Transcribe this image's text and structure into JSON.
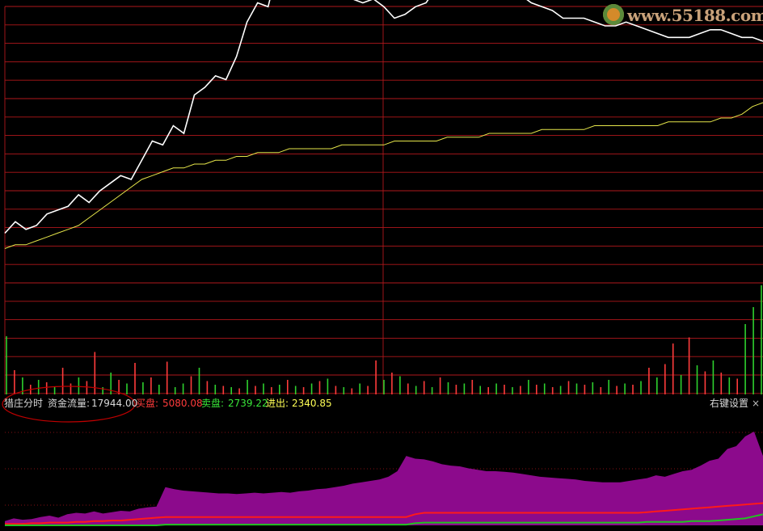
{
  "watermark": {
    "text": "www.55188.com"
  },
  "info": {
    "indicator_name": "猎庄分时",
    "flow_label": "资金流量:",
    "flow_value": "17944.00",
    "buy_label": "买盘:",
    "buy_value": "5080.08",
    "sell_label": "卖盘:",
    "sell_value": "2739.22",
    "net_label": "进出:",
    "net_value": "2340.85",
    "settings_label": "右键设置",
    "close_glyph": "×"
  },
  "colors": {
    "grid": "#b0171b",
    "price": "#ffffff",
    "avg": "#e6e64a",
    "vol_up": "#ff3b3b",
    "vol_down": "#2ed12e",
    "fill": "#8c0a8c",
    "buy": "#ff1a1a",
    "sell": "#21c421",
    "buy_text": "#ff3b3b",
    "sell_text": "#39e639",
    "net_text": "#ffff55",
    "label_text": "#d8d8d8",
    "ellipse": "#c00000",
    "axis_text": "#c0c0c0"
  },
  "chart_data": [
    {
      "type": "line",
      "series": [
        {
          "values": [
            42,
            45,
            43,
            44,
            47,
            48,
            49,
            52,
            50,
            53,
            55,
            57,
            56,
            61,
            66,
            65,
            70,
            68,
            78,
            80,
            83,
            82,
            88,
            97,
            102,
            101,
            112,
            110,
            107,
            106,
            105,
            104,
            104,
            103,
            102,
            103,
            101,
            98,
            99,
            101,
            102,
            106,
            108,
            110,
            112,
            112,
            112,
            108,
            107,
            104,
            102,
            101,
            100,
            98,
            98,
            98,
            97,
            96,
            96,
            97,
            96,
            95,
            94,
            93,
            93,
            93,
            94,
            95,
            95,
            94,
            93,
            93,
            92
          ]
        },
        {
          "values": [
            38,
            39,
            39,
            40,
            41,
            42,
            43,
            44,
            46,
            48,
            50,
            52,
            54,
            56,
            57,
            58,
            59,
            59,
            60,
            60,
            61,
            61,
            62,
            62,
            63,
            63,
            63,
            64,
            64,
            64,
            64,
            64,
            65,
            65,
            65,
            65,
            65,
            66,
            66,
            66,
            66,
            66,
            67,
            67,
            67,
            67,
            68,
            68,
            68,
            68,
            68,
            69,
            69,
            69,
            69,
            69,
            70,
            70,
            70,
            70,
            70,
            70,
            70,
            71,
            71,
            71,
            71,
            71,
            72,
            72,
            73,
            75,
            76
          ]
        }
      ]
    },
    {
      "type": "bar",
      "values": [
        48,
        20,
        14,
        8,
        12,
        10,
        6,
        22,
        9,
        14,
        11,
        35,
        6,
        18,
        12,
        9,
        26,
        10,
        14,
        8,
        27,
        6,
        9,
        15,
        22,
        11,
        8,
        7,
        6,
        5,
        12,
        7,
        9,
        6,
        8,
        12,
        7,
        6,
        9,
        11,
        13,
        7,
        6,
        5,
        9,
        7,
        28,
        12,
        18,
        15,
        9,
        7,
        11,
        6,
        14,
        10,
        8,
        9,
        12,
        7,
        6,
        9,
        8,
        6,
        7,
        12,
        8,
        9,
        6,
        7,
        11,
        9,
        8,
        10,
        6,
        12,
        7,
        9,
        8,
        11,
        22,
        14,
        25,
        42,
        16,
        47,
        24,
        19,
        28,
        18,
        14,
        13,
        58,
        72,
        90
      ],
      "colors": [
        "down",
        "up",
        "down",
        "up",
        "down",
        "up",
        "down",
        "up",
        "up",
        "down",
        "up",
        "up",
        "down",
        "down",
        "up",
        "down",
        "up",
        "down",
        "up",
        "down",
        "up",
        "down",
        "down",
        "up",
        "down",
        "up",
        "down",
        "up",
        "down",
        "up",
        "down",
        "up",
        "down",
        "up",
        "down",
        "up",
        "down",
        "up",
        "down",
        "up",
        "down",
        "up",
        "down",
        "up",
        "down",
        "up",
        "up",
        "down",
        "up",
        "down",
        "up",
        "down",
        "up",
        "down",
        "up",
        "down",
        "up",
        "down",
        "up",
        "down",
        "up",
        "down",
        "up",
        "down",
        "up",
        "down",
        "up",
        "down",
        "up",
        "down",
        "up",
        "down",
        "up",
        "down",
        "up",
        "down",
        "up",
        "down",
        "up",
        "down",
        "up",
        "down",
        "up",
        "up",
        "down",
        "up",
        "down",
        "up",
        "down",
        "up",
        "down",
        "up",
        "down",
        "down",
        "down"
      ]
    },
    {
      "type": "area",
      "series": [
        {
          "values": [
            6,
            10,
            8,
            9,
            12,
            14,
            11,
            16,
            18,
            17,
            20,
            17,
            19,
            21,
            20,
            24,
            26,
            27,
            55,
            52,
            50,
            49,
            48,
            47,
            46,
            46,
            45,
            46,
            47,
            46,
            47,
            48,
            47,
            49,
            50,
            52,
            53,
            55,
            57,
            60,
            62,
            64,
            66,
            70,
            78,
            100,
            96,
            95,
            92,
            88,
            86,
            85,
            82,
            80,
            78,
            78,
            77,
            76,
            74,
            72,
            70,
            69,
            68,
            67,
            66,
            64,
            63,
            62,
            62,
            62,
            64,
            66,
            68,
            72,
            70,
            74,
            78,
            80,
            86,
            93,
            96,
            110,
            114,
            128,
            135,
            100
          ]
        },
        {
          "values": [
            2,
            2,
            2,
            3,
            3,
            4,
            4,
            4,
            5,
            5,
            6,
            6,
            7,
            7,
            8,
            9,
            10,
            11,
            12,
            12,
            12,
            12,
            12,
            12,
            12,
            12,
            12,
            12,
            12,
            12,
            12,
            12,
            12,
            12,
            12,
            12,
            12,
            12,
            12,
            12,
            12,
            12,
            12,
            12,
            12,
            12,
            16,
            18,
            18,
            18,
            18,
            18,
            18,
            18,
            18,
            18,
            18,
            18,
            18,
            18,
            18,
            18,
            18,
            18,
            18,
            18,
            18,
            18,
            18,
            18,
            18,
            18,
            19,
            20,
            21,
            22,
            23,
            24,
            25,
            26,
            27,
            28,
            29,
            30,
            31,
            32
          ]
        },
        {
          "values": [
            0,
            0,
            0,
            0,
            0,
            0,
            0,
            0,
            0,
            0,
            0,
            0,
            0,
            0,
            0,
            0,
            0,
            0,
            1,
            1,
            1,
            1,
            1,
            1,
            1,
            1,
            1,
            1,
            1,
            1,
            1,
            1,
            1,
            1,
            1,
            1,
            1,
            1,
            1,
            1,
            1,
            1,
            1,
            1,
            1,
            1,
            3,
            4,
            4,
            4,
            4,
            4,
            4,
            4,
            4,
            4,
            4,
            4,
            4,
            4,
            4,
            4,
            4,
            4,
            4,
            4,
            4,
            4,
            4,
            4,
            4,
            4,
            5,
            5,
            5,
            5,
            5,
            6,
            6,
            6,
            7,
            8,
            9,
            10,
            13,
            16
          ]
        }
      ]
    }
  ]
}
